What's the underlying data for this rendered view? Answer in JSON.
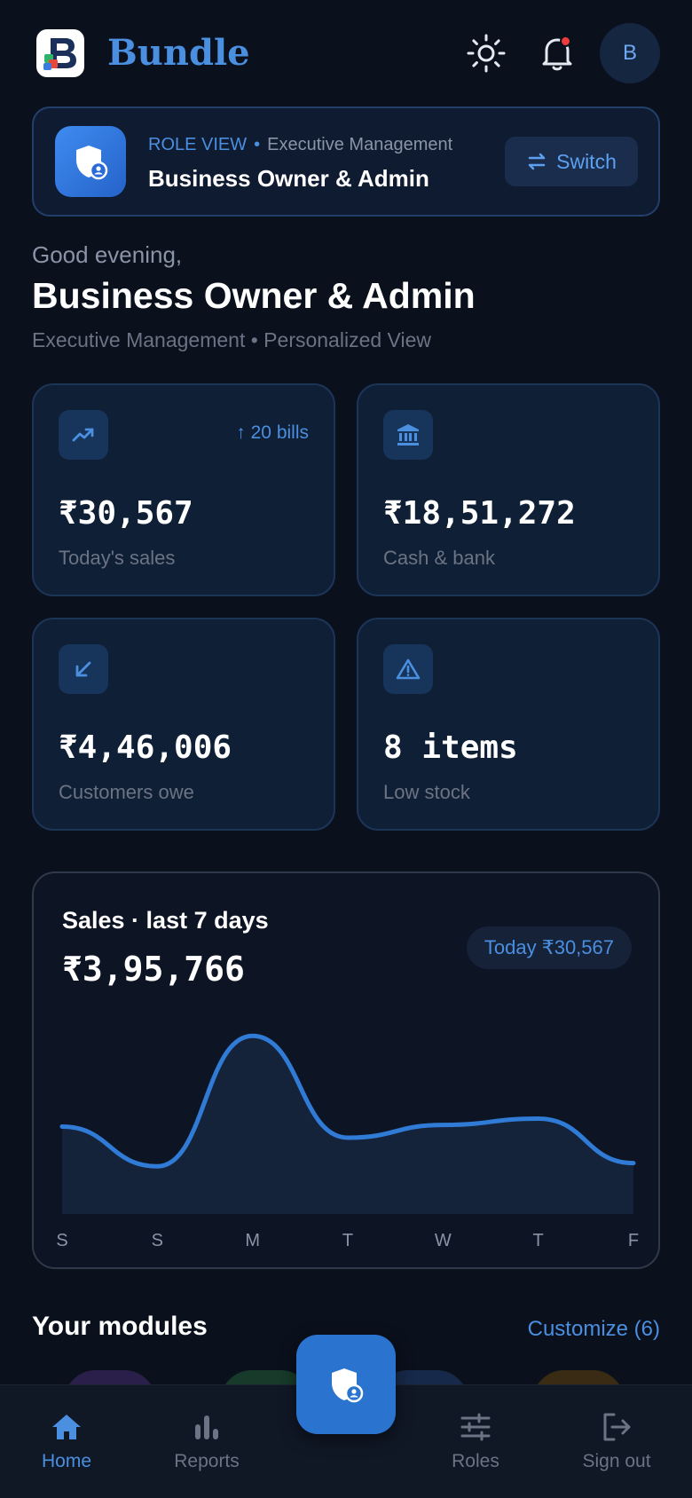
{
  "app": {
    "title": "Bundle"
  },
  "header": {
    "avatar_initial": "B",
    "has_notification": true
  },
  "role": {
    "tag": "ROLE VIEW",
    "department": "Executive Management",
    "name": "Business Owner & Admin",
    "switch_label": "Switch"
  },
  "greeting": {
    "salutation": "Good evening,",
    "name": "Business Owner & Admin",
    "subtitle": "Executive Management • Personalized View"
  },
  "stats": [
    {
      "icon": "trending-up-icon",
      "delta": "↑ 20 bills",
      "value": "₹30,567",
      "label": "Today's sales"
    },
    {
      "icon": "bank-icon",
      "value": "₹18,51,272",
      "label": "Cash & bank"
    },
    {
      "icon": "arrow-down-left-icon",
      "value": "₹4,46,006",
      "label": "Customers owe"
    },
    {
      "icon": "warning-icon",
      "value": "8 items",
      "label": "Low stock"
    }
  ],
  "sales": {
    "title": "Sales · last 7 days",
    "total": "₹3,95,766",
    "today_label": "Today ₹30,567"
  },
  "chart_data": {
    "type": "area",
    "categories": [
      "S",
      "S",
      "M",
      "T",
      "W",
      "T",
      "F"
    ],
    "values": [
      55000,
      30000,
      112000,
      48000,
      56000,
      60000,
      32000
    ],
    "ylim": [
      0,
      125000
    ],
    "grid": false,
    "color": "#2f7bd6"
  },
  "modules": {
    "title": "Your modules",
    "customize_label": "Customize (6)",
    "peek_colors": [
      "#2a1f4a",
      "#173a2a",
      "#17294a",
      "#3a2c14"
    ]
  },
  "nav": {
    "items": [
      {
        "label": "Home",
        "icon": "home-icon",
        "active": true
      },
      {
        "label": "Reports",
        "icon": "bar-chart-icon",
        "active": false
      },
      {
        "label": "Roles",
        "icon": "sliders-icon",
        "active": false
      },
      {
        "label": "Sign out",
        "icon": "sign-out-icon",
        "active": false
      }
    ],
    "fab_icon": "role-shield-icon"
  },
  "colors": {
    "accent": "#4a8fe0",
    "background": "#0a101c",
    "card": "#0f1f35",
    "alert": "#ef3b3b"
  }
}
